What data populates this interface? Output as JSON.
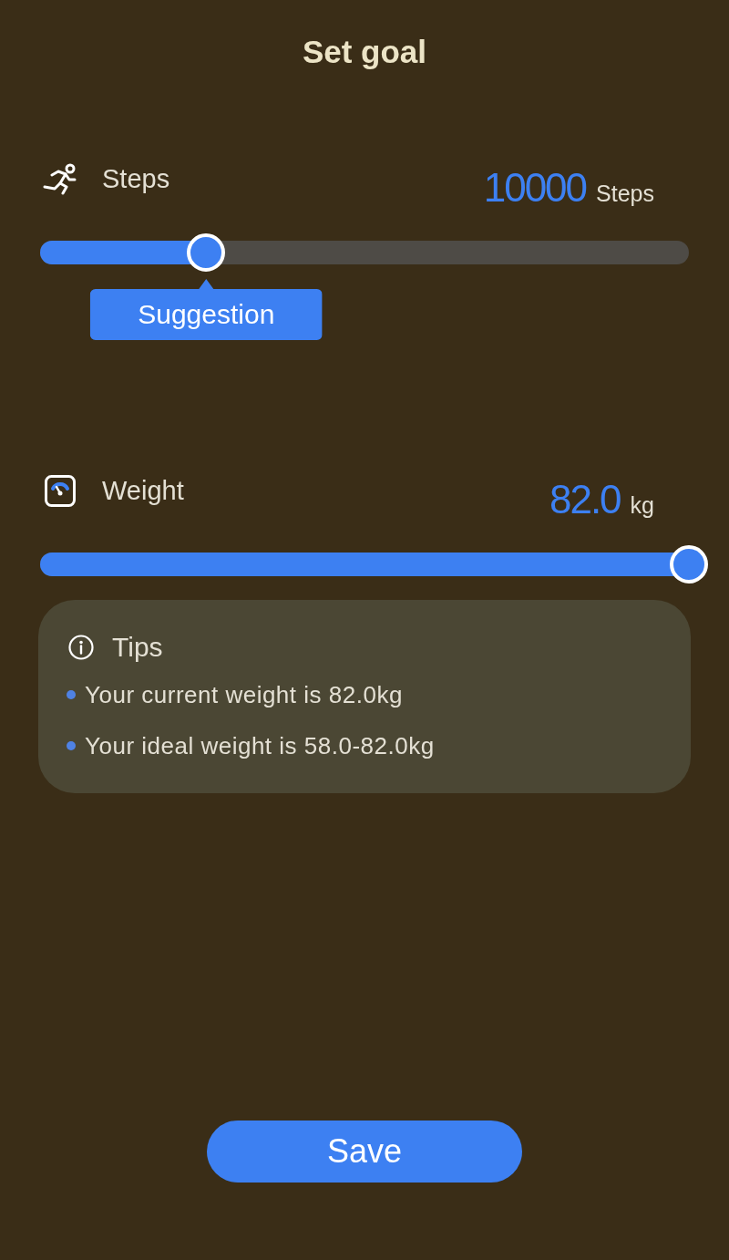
{
  "title": "Set goal",
  "goals": [
    {
      "kind": "steps",
      "label": "Steps",
      "value": "10000",
      "unit": "Steps",
      "level": 0.256,
      "tooltip": "Suggestion"
    },
    {
      "kind": "weight",
      "label": "Weight",
      "value": "82.0",
      "unit": "kg",
      "level": 1
    }
  ],
  "tips": {
    "title": "Tips",
    "items": [
      "Your current weight is 82.0kg",
      "Your ideal weight is 58.0-82.0kg"
    ]
  },
  "save_button": "Save"
}
